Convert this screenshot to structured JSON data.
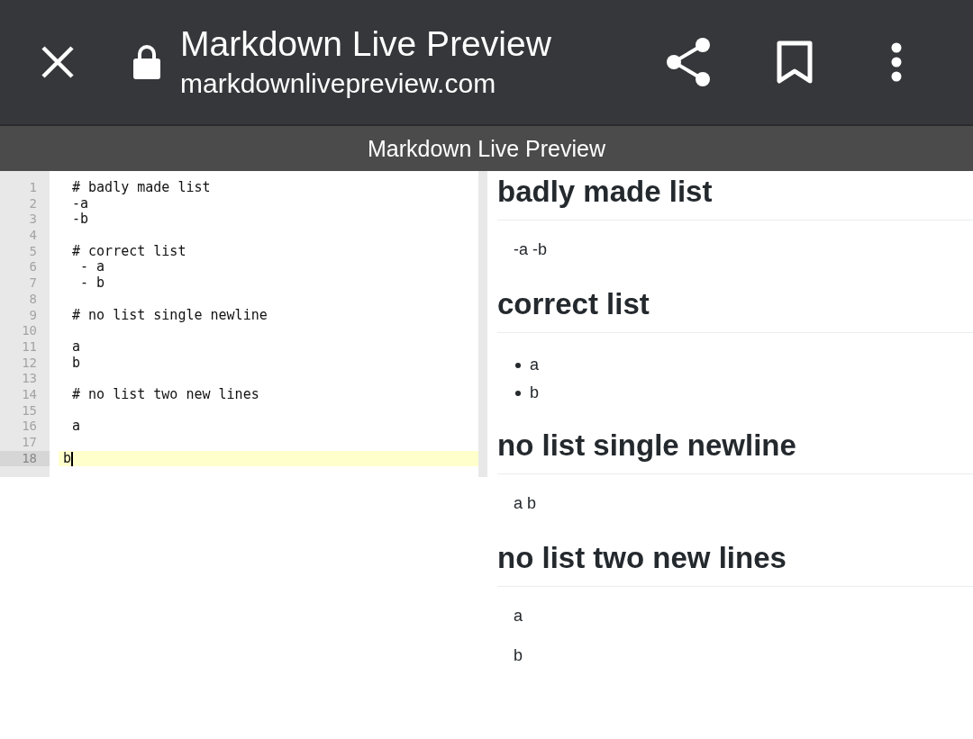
{
  "browser_bar": {
    "title": "Markdown Live Preview",
    "url": "markdownlivepreview.com"
  },
  "app_header": {
    "title": "Markdown Live Preview"
  },
  "editor": {
    "lines": [
      {
        "number": "1",
        "text": "# badly made list",
        "active": false
      },
      {
        "number": "2",
        "text": "-a",
        "active": false
      },
      {
        "number": "3",
        "text": "-b",
        "active": false
      },
      {
        "number": "4",
        "active": false
      },
      {
        "number": "5",
        "text": "# correct list",
        "active": false
      },
      {
        "number": "6",
        "text": " - a",
        "active": false
      },
      {
        "number": "7",
        "text": " - b",
        "active": false
      },
      {
        "number": "8",
        "active": false
      },
      {
        "number": "9",
        "text": "# no list single newline",
        "active": false
      },
      {
        "number": "10",
        "active": false
      },
      {
        "number": "11",
        "text": "a",
        "active": false
      },
      {
        "number": "12",
        "text": "b",
        "active": false
      },
      {
        "number": "13",
        "active": false
      },
      {
        "number": "14",
        "text": "# no list two new lines",
        "active": false
      },
      {
        "number": "15",
        "active": false
      },
      {
        "number": "16",
        "text": "a",
        "active": false
      },
      {
        "number": "17",
        "active": false
      },
      {
        "number": "18",
        "text": "b",
        "active": true
      }
    ]
  },
  "preview": {
    "blocks": [
      {
        "kind": "heading",
        "text": "badly made list"
      },
      {
        "kind": "paragraph",
        "text": "-a -b"
      },
      {
        "kind": "heading",
        "text": "correct list"
      },
      {
        "kind": "list",
        "items": [
          "a",
          "b"
        ]
      },
      {
        "kind": "heading",
        "text": "no list single newline"
      },
      {
        "kind": "paragraph",
        "text": "a b"
      },
      {
        "kind": "heading",
        "text": "no list two new lines"
      },
      {
        "kind": "paragraph",
        "text": "a"
      },
      {
        "kind": "paragraph",
        "text": "b"
      }
    ]
  }
}
